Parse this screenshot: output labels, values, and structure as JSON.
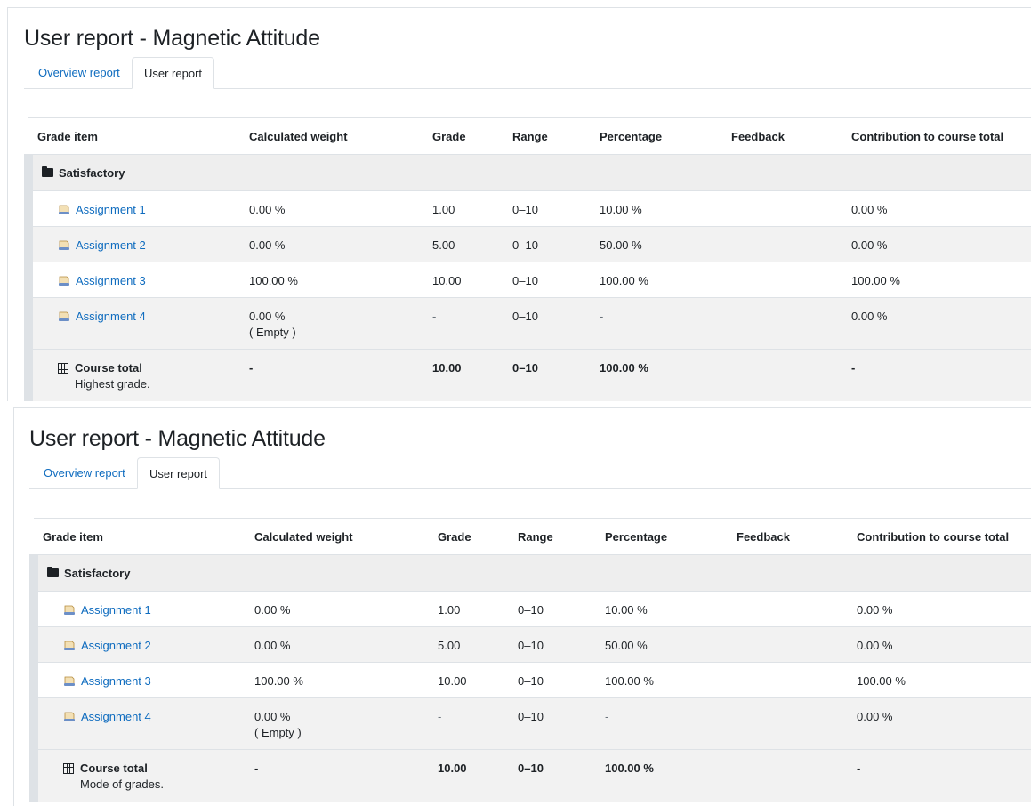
{
  "reports": [
    {
      "title": "User report - Magnetic Attitude",
      "tabs": [
        "Overview report",
        "User report"
      ],
      "headers": [
        "Grade item",
        "Calculated weight",
        "Grade",
        "Range",
        "Percentage",
        "Feedback",
        "Contribution to course total"
      ],
      "category": "Satisfactory",
      "items": [
        {
          "name": "Assignment 1",
          "weight": "0.00 %",
          "grade": "1.00",
          "range": "0–10",
          "percentage": "10.00 %",
          "feedback": "",
          "contribution": "0.00 %"
        },
        {
          "name": "Assignment 2",
          "weight": "0.00 %",
          "grade": "5.00",
          "range": "0–10",
          "percentage": "50.00 %",
          "feedback": "",
          "contribution": "0.00 %"
        },
        {
          "name": "Assignment 3",
          "weight": "100.00 %",
          "grade": "10.00",
          "range": "0–10",
          "percentage": "100.00 %",
          "feedback": "",
          "contribution": "100.00 %"
        },
        {
          "name": "Assignment 4",
          "weight": "0.00 %",
          "weight_note": "( Empty )",
          "grade": "-",
          "range": "0–10",
          "percentage": "-",
          "feedback": "",
          "contribution": "0.00 %"
        }
      ],
      "total": {
        "name": "Course total",
        "note": "Highest grade.",
        "weight": "-",
        "grade": "10.00",
        "range": "0–10",
        "percentage": "100.00 %",
        "feedback": "",
        "contribution": "-"
      }
    },
    {
      "title": "User report - Magnetic Attitude",
      "tabs": [
        "Overview report",
        "User report"
      ],
      "headers": [
        "Grade item",
        "Calculated weight",
        "Grade",
        "Range",
        "Percentage",
        "Feedback",
        "Contribution to course total"
      ],
      "category": "Satisfactory",
      "items": [
        {
          "name": "Assignment 1",
          "weight": "0.00 %",
          "grade": "1.00",
          "range": "0–10",
          "percentage": "10.00 %",
          "feedback": "",
          "contribution": "0.00 %"
        },
        {
          "name": "Assignment 2",
          "weight": "0.00 %",
          "grade": "5.00",
          "range": "0–10",
          "percentage": "50.00 %",
          "feedback": "",
          "contribution": "0.00 %"
        },
        {
          "name": "Assignment 3",
          "weight": "100.00 %",
          "grade": "10.00",
          "range": "0–10",
          "percentage": "100.00 %",
          "feedback": "",
          "contribution": "100.00 %"
        },
        {
          "name": "Assignment 4",
          "weight": "0.00 %",
          "weight_note": "( Empty )",
          "grade": "-",
          "range": "0–10",
          "percentage": "-",
          "feedback": "",
          "contribution": "0.00 %"
        }
      ],
      "total": {
        "name": "Course total",
        "note": "Mode of grades.",
        "weight": "-",
        "grade": "10.00",
        "range": "0–10",
        "percentage": "100.00 %",
        "feedback": "",
        "contribution": "-"
      }
    }
  ],
  "colors": {
    "link": "#0f6cbf",
    "text": "#1d2125",
    "border": "#dee2e6",
    "category_bg": "#eeeeee"
  },
  "icons": {
    "category": "folder-icon",
    "item": "assignment-icon",
    "total": "calculator-icon"
  }
}
